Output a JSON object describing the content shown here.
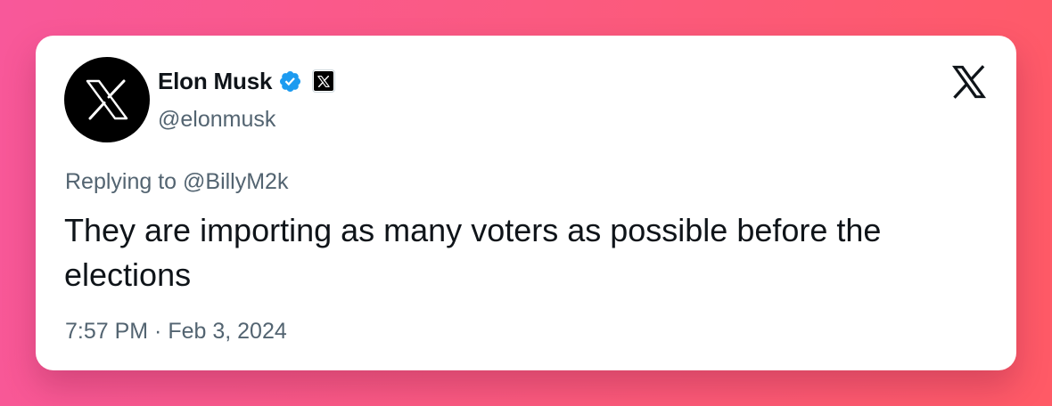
{
  "colors": {
    "verified": "#1d9bf0",
    "text_primary": "#0f1419",
    "text_secondary": "#536471",
    "background_start": "#f8589a",
    "background_end": "#ff5a66"
  },
  "author": {
    "avatar_icon": "x-logo-icon",
    "display_name": "Elon Musk",
    "verified_icon": "verified-badge-icon",
    "affiliation_icon": "x-affiliation-icon",
    "handle": "@elonmusk"
  },
  "platform_icon": "x-logo-icon",
  "tweet": {
    "replying_to": "Replying to @BillyM2k",
    "text": "They are importing as many voters as possible before the elections",
    "timestamp": "7:57 PM · Feb 3, 2024"
  }
}
